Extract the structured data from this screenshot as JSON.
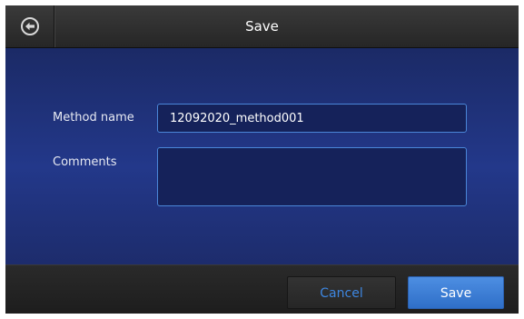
{
  "header": {
    "title": "Save",
    "back_icon": "back-arrow-circle-icon"
  },
  "form": {
    "method_name_label": "Method name",
    "method_name_value": "12092020_method001",
    "comments_label": "Comments",
    "comments_value": ""
  },
  "footer": {
    "cancel_label": "Cancel",
    "save_label": "Save"
  },
  "colors": {
    "content_background": "#23388a",
    "field_border": "#4a86d8",
    "cancel_text": "#3d86e0",
    "save_button": "#3f7fd6"
  }
}
